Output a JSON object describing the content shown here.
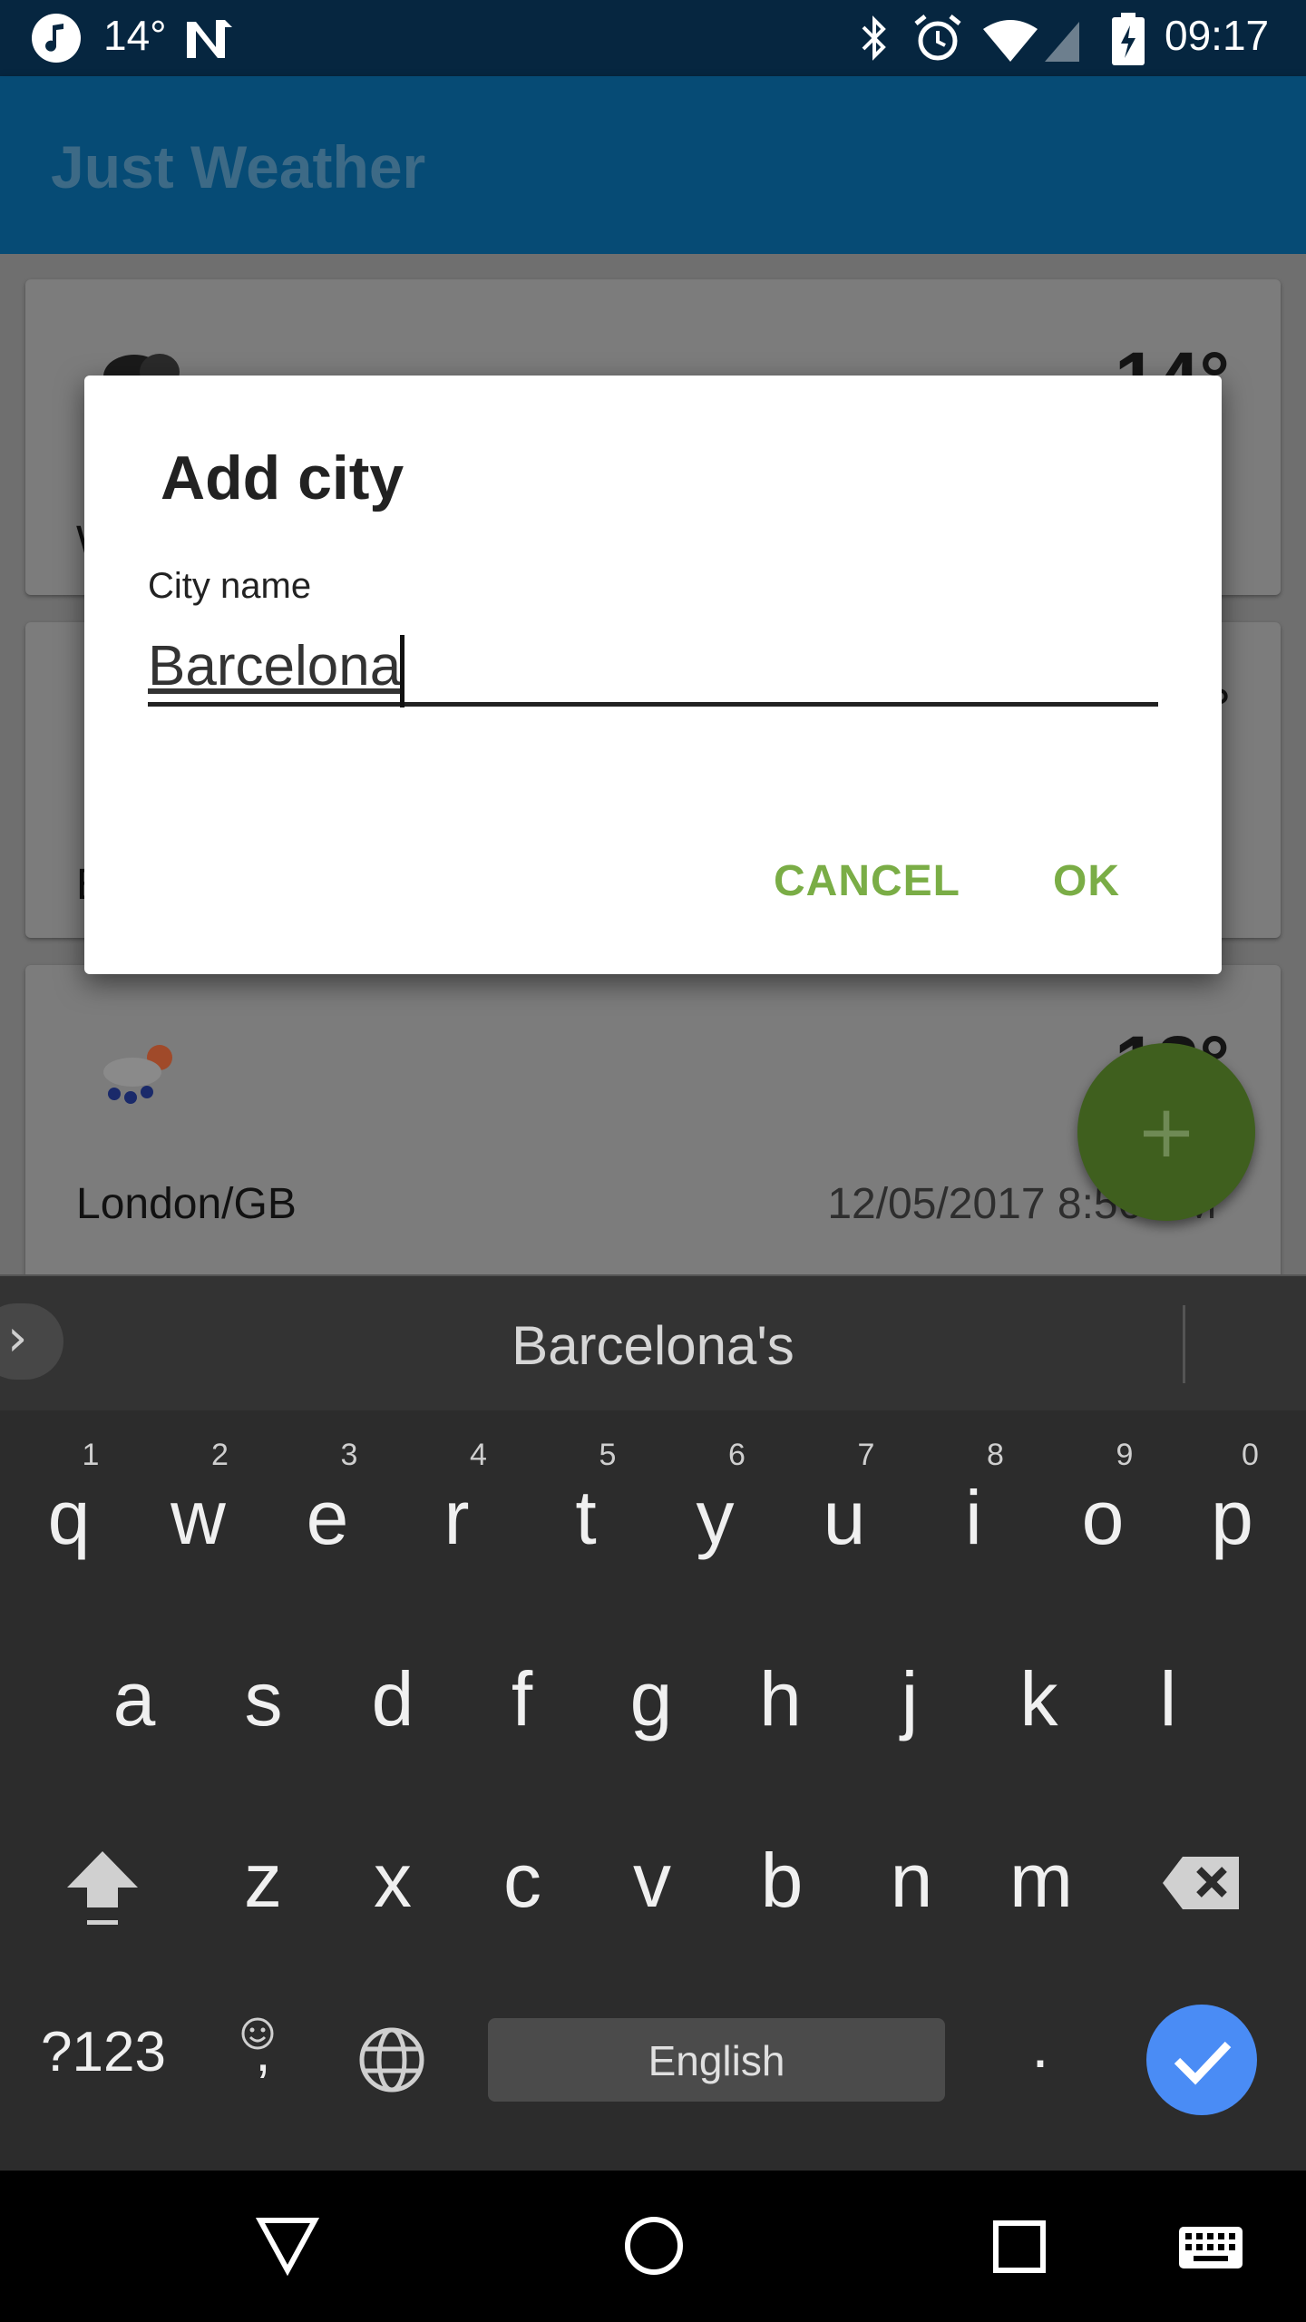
{
  "status_bar": {
    "temperature": "14°",
    "time": "09:17",
    "icons": [
      "music-note-icon",
      "n-notification-icon",
      "bluetooth-icon",
      "alarm-icon",
      "wifi-icon",
      "cell-signal-icon",
      "battery-icon"
    ]
  },
  "app_bar": {
    "title": "Just Weather"
  },
  "cards": [
    {
      "city": "W",
      "temp": "14°",
      "icon": "cloud-icon"
    },
    {
      "city": "B",
      "temp": "°",
      "icon": "weather-icon"
    },
    {
      "city": "London/GB",
      "temp": "13°",
      "updated": "12/05/2017 8:56 AM",
      "icon": "rain-sun-icon"
    }
  ],
  "fab": {
    "label": "+"
  },
  "dialog": {
    "title": "Add city",
    "field_label": "City name",
    "field_value": "Barcelona",
    "cancel_label": "CANCEL",
    "ok_label": "OK"
  },
  "keyboard": {
    "suggestion": "Barcelona's",
    "row1": [
      "q",
      "w",
      "e",
      "r",
      "t",
      "y",
      "u",
      "i",
      "o",
      "p"
    ],
    "row1_hints": [
      "1",
      "2",
      "3",
      "4",
      "5",
      "6",
      "7",
      "8",
      "9",
      "0"
    ],
    "row2": [
      "a",
      "s",
      "d",
      "f",
      "g",
      "h",
      "j",
      "k",
      "l"
    ],
    "row3": [
      "z",
      "x",
      "c",
      "v",
      "b",
      "n",
      "m"
    ],
    "symbols_label": "?123",
    "emoji_label": ",",
    "space_label": "English",
    "period_label": "."
  },
  "colors": {
    "status_bar": "#062640",
    "app_bar": "#064b75",
    "accent": "#7aad46",
    "fab": "#3f5f1e",
    "enter_key": "#4a8cf5"
  }
}
